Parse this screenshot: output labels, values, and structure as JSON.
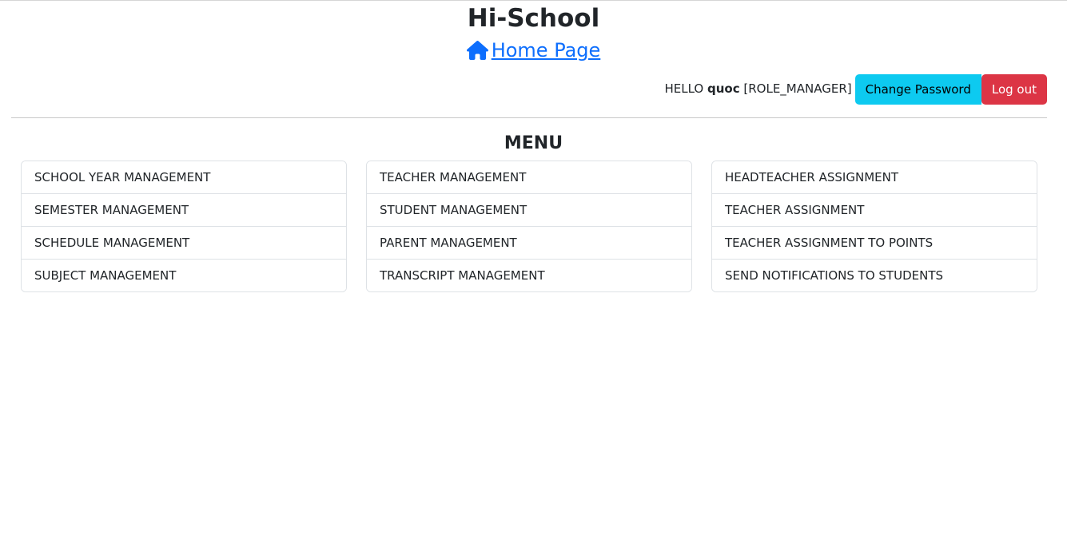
{
  "header": {
    "site_title": "Hi-School",
    "home_link_label": " Home Page",
    "home_icon": "home-icon"
  },
  "user_bar": {
    "hello": "HELLO ",
    "username": "quoc",
    "role": " [ROLE_MANAGER]",
    "change_password_label": "Change Password",
    "logout_label": "Log out"
  },
  "colors": {
    "link": "#0d6efd",
    "info_button": "#0dcaf0",
    "danger_button": "#dc3545"
  },
  "menu": {
    "title": "MENU",
    "columns": [
      {
        "items": [
          "SCHOOL YEAR MANAGEMENT",
          "SEMESTER MANAGEMENT",
          "SCHEDULE MANAGEMENT",
          "SUBJECT MANAGEMENT"
        ]
      },
      {
        "items": [
          "TEACHER MANAGEMENT",
          "STUDENT MANAGEMENT",
          "PARENT MANAGEMENT",
          "TRANSCRIPT MANAGEMENT"
        ]
      },
      {
        "items": [
          "HEADTEACHER ASSIGNMENT",
          "TEACHER ASSIGNMENT",
          "TEACHER ASSIGNMENT TO POINTS",
          "SEND NOTIFICATIONS TO STUDENTS"
        ]
      }
    ]
  }
}
